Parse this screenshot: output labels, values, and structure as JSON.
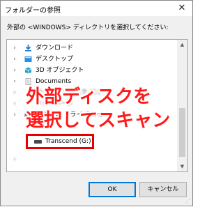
{
  "window": {
    "title": "フォルダーの参照",
    "close_glyph": "✕"
  },
  "prompt": "外部の <WINDOWS> ディレクトリを選択してください:",
  "tree": {
    "items": [
      {
        "label": "ダウンロード",
        "icon": "download-arrow-icon",
        "color": "#1e7bd6"
      },
      {
        "label": "デスクトップ",
        "icon": "desktop-folder-icon",
        "color": "#2b8fe0"
      },
      {
        "label": "3D オブジェクト",
        "icon": "3d-objects-icon",
        "color": "#27a3c9"
      },
      {
        "label": "Documents",
        "icon": "documents-icon",
        "color": "#9c9c9c"
      },
      {
        "label": "DVD RW ドライブ (D:)",
        "icon": "dvd-drive-icon",
        "color": "#666666"
      },
      {
        "label": "Transcend (G:)",
        "icon": "usb-drive-icon",
        "color": "#4a4a4a"
      }
    ],
    "blurred_rows": [
      "ローカル ディスク (C:)",
      "ネットワーク"
    ],
    "scroll_up_glyph": "▲",
    "scroll_down_glyph": "▼",
    "expand_glyph": "›"
  },
  "overlay": {
    "line1": "外部ディスクを",
    "line2": "選択してスキャン",
    "color": "#ff1a1a"
  },
  "buttons": {
    "ok": "OK",
    "cancel": "キャンセル"
  },
  "colors": {
    "highlight_border": "#e60000",
    "accent": "#0078d7"
  }
}
